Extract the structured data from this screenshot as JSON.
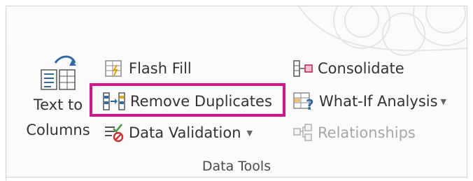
{
  "ribbon": {
    "text_to_columns": {
      "line1": "Text to",
      "line2": "Columns",
      "icon": "text-to-columns-icon"
    },
    "flash_fill": {
      "label": "Flash Fill",
      "icon": "flash-fill-icon"
    },
    "remove_duplicates": {
      "label": "Remove Duplicates",
      "icon": "remove-duplicates-icon",
      "highlight_color": "#d8148c"
    },
    "data_validation": {
      "label": "Data Validation",
      "icon": "data-validation-icon",
      "has_dropdown": true
    },
    "consolidate": {
      "label": "Consolidate",
      "icon": "consolidate-icon"
    },
    "what_if_analysis": {
      "label": "What-If Analysis",
      "icon": "what-if-analysis-icon",
      "has_dropdown": true
    },
    "relationships": {
      "label": "Relationships",
      "icon": "relationships-icon",
      "disabled": true
    },
    "group_label": "Data Tools"
  }
}
